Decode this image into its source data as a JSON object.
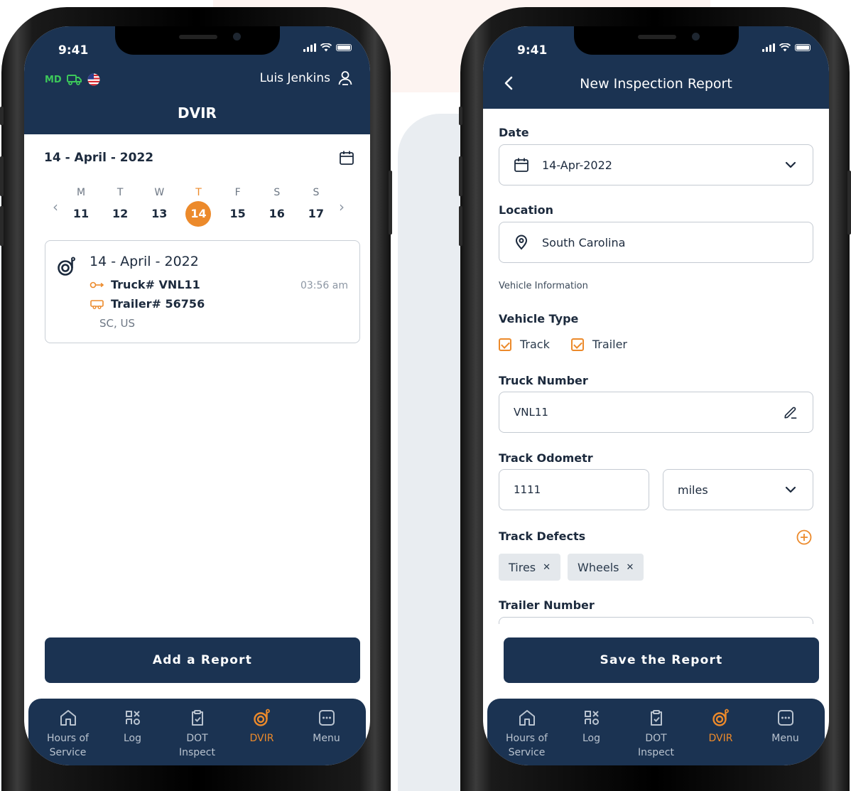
{
  "status_time": "9:41",
  "colors": {
    "navy": "#1b3352",
    "accent": "#ec8a2b",
    "md_green": "#3cc85a"
  },
  "left": {
    "md_label": "MD",
    "user_name": "Luis Jenkins",
    "title": "DVIR",
    "date_label": "14 - April - 2022",
    "week": [
      {
        "name": "M",
        "num": "11"
      },
      {
        "name": "T",
        "num": "12"
      },
      {
        "name": "W",
        "num": "13"
      },
      {
        "name": "T",
        "num": "14"
      },
      {
        "name": "F",
        "num": "15"
      },
      {
        "name": "S",
        "num": "16"
      },
      {
        "name": "S",
        "num": "17"
      }
    ],
    "report": {
      "date": "14 - April - 2022",
      "truck": "Truck# VNL11",
      "trailer": "Trailer# 56756",
      "location": "SC, US",
      "time": "03:56 am"
    },
    "button": "Add a Report"
  },
  "right": {
    "title": "New Inspection Report",
    "date_label": "Date",
    "date_value": "14-Apr-2022",
    "location_label": "Location",
    "location_value": "South Carolina",
    "vehicle_info_label": "Vehicle Information",
    "vehicle_type_label": "Vehicle Type",
    "vehicle_types": [
      "Track",
      "Trailer"
    ],
    "truck_number_label": "Truck Number",
    "truck_number_value": "VNL11",
    "odometer_label": "Track Odometr",
    "odometer_value": "1111",
    "odometer_unit": "miles",
    "defects_label": "Track Defects",
    "defects": [
      "Tires",
      "Wheels"
    ],
    "trailer_number_label": "Trailer Number",
    "button": "Save the Report"
  },
  "tabs": [
    {
      "line1": "Hours of",
      "line2": "Service",
      "icon": "home-icon"
    },
    {
      "line1": "Log",
      "line2": "",
      "icon": "log-icon"
    },
    {
      "line1": "DOT",
      "line2": "Inspect",
      "icon": "clipboard-icon"
    },
    {
      "line1": "DVIR",
      "line2": "",
      "icon": "dvir-icon"
    },
    {
      "line1": "Menu",
      "line2": "",
      "icon": "menu-icon"
    }
  ]
}
